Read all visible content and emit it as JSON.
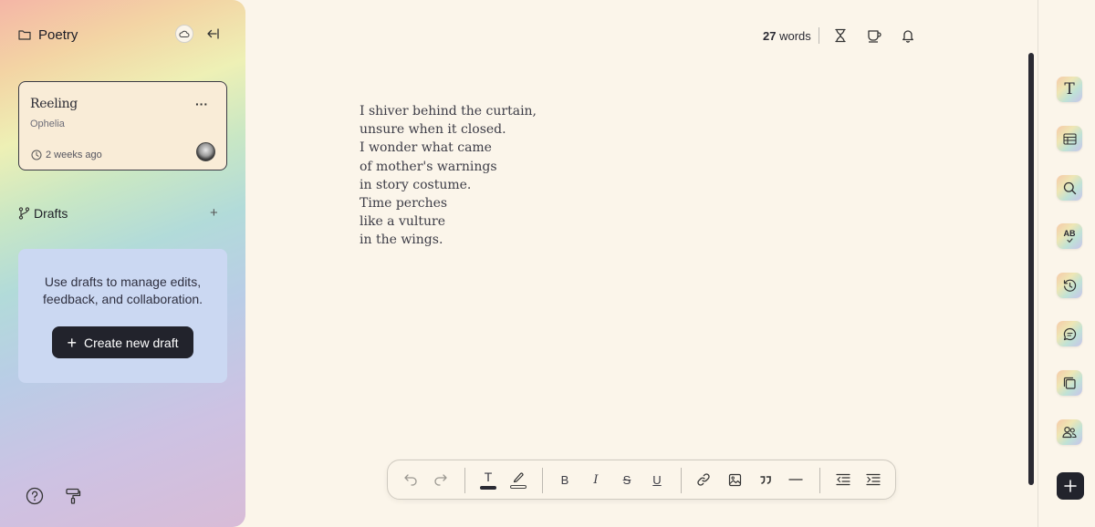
{
  "sidebar": {
    "folder_name": "Poetry",
    "document": {
      "title": "Reeling",
      "author": "Ophelia",
      "updated": "2 weeks ago"
    },
    "drafts_label": "Drafts",
    "drafts_message": "Use drafts to manage edits, feedback, and collaboration.",
    "create_draft_label": "Create new draft"
  },
  "topbar": {
    "word_count": "27",
    "word_label": "words"
  },
  "editor": {
    "lines": [
      "I shiver behind the curtain,",
      "unsure when it closed.",
      "I wonder what came",
      "of mother's warnings",
      "in story costume.",
      "Time perches",
      "like a vulture",
      "in the wings."
    ]
  },
  "toolbar": {
    "bold_label": "B",
    "italic_label": "I",
    "strike_label": "S",
    "underline_label": "U",
    "text_color_label": "T"
  },
  "right_rail": {
    "icons": [
      "text-style-icon",
      "table-icon",
      "search-icon",
      "spellcheck-icon",
      "history-icon",
      "comment-icon",
      "notes-icon",
      "collaborators-icon",
      "add-icon"
    ],
    "text_style_label": "T",
    "spellcheck_label": "AB"
  },
  "colors": {
    "background": "#fbf5ea",
    "dark": "#22232c",
    "drafts_panel": "#cbd8f2",
    "card": "#f9ecd7"
  }
}
